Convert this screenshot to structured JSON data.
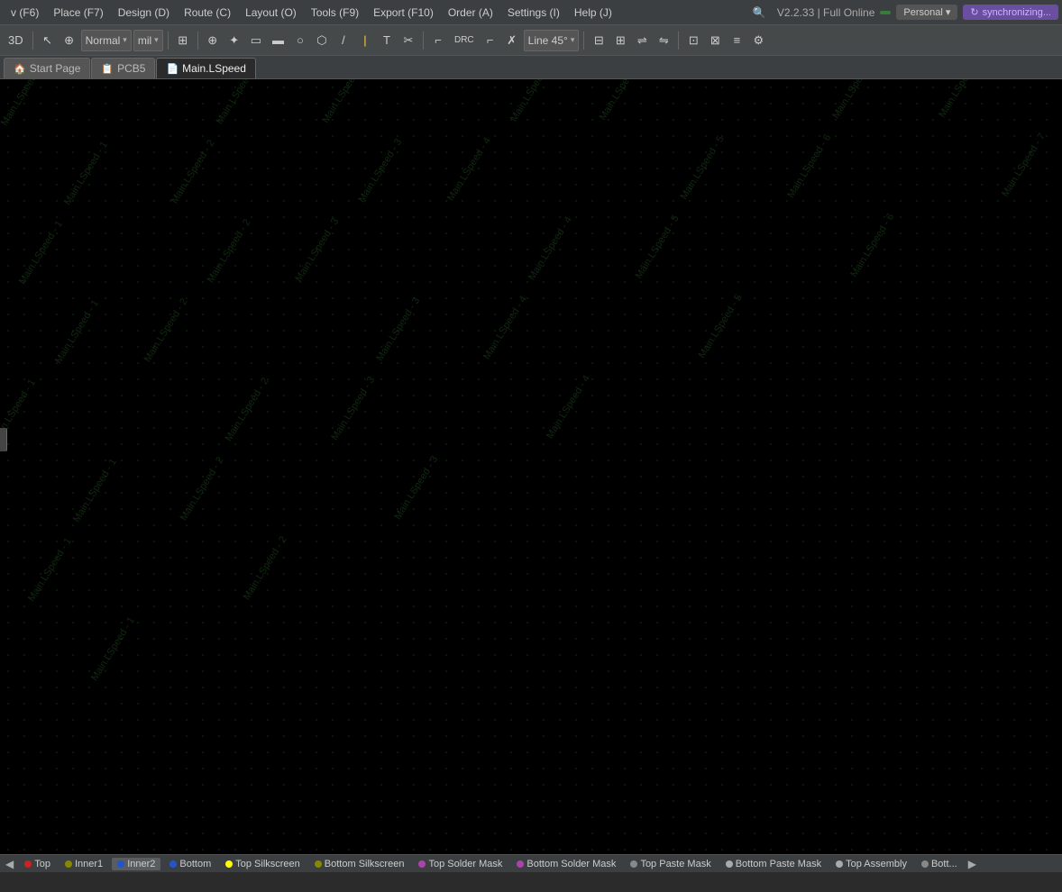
{
  "menubar": {
    "items": [
      {
        "label": "v (F6)",
        "shortcut": "F6"
      },
      {
        "label": "Place (F7)",
        "shortcut": "F7"
      },
      {
        "label": "Design (D)",
        "shortcut": "D"
      },
      {
        "label": "Route (C)",
        "shortcut": "C"
      },
      {
        "label": "Layout (O)",
        "shortcut": "O"
      },
      {
        "label": "Tools (F9)",
        "shortcut": "F9"
      },
      {
        "label": "Export (F10)",
        "shortcut": "F10"
      },
      {
        "label": "Order (A)",
        "shortcut": "A"
      },
      {
        "label": "Settings (I)",
        "shortcut": "I"
      },
      {
        "label": "Help (J)",
        "shortcut": "J"
      }
    ],
    "version": "V2.2.33 | Full Online",
    "personal_label": "Personal",
    "sync_label": "synchronizing..."
  },
  "toolbar": {
    "mode_label": "Normal",
    "unit_label": "mil",
    "line_angle_label": "Line 45°",
    "btn_3d": "3D"
  },
  "tabs": [
    {
      "label": "Start Page",
      "icon": "🏠",
      "active": false
    },
    {
      "label": "PCB5",
      "icon": "📋",
      "active": false
    },
    {
      "label": "Main.LSpeed",
      "icon": "📄",
      "active": true
    }
  ],
  "layers": [
    {
      "label": "Top",
      "color": "#cc2222",
      "active": false
    },
    {
      "label": "Inner1",
      "color": "#888800",
      "active": false
    },
    {
      "label": "Inner2",
      "color": "#2255cc",
      "active": true
    },
    {
      "label": "Bottom",
      "color": "#2255cc",
      "active": false
    },
    {
      "label": "Top Silkscreen",
      "color": "#ffff00",
      "active": false
    },
    {
      "label": "Bottom Silkscreen",
      "color": "#888800",
      "active": false
    },
    {
      "label": "Top Solder Mask",
      "color": "#aa44aa",
      "active": false
    },
    {
      "label": "Bottom Solder Mask",
      "color": "#aa44aa",
      "active": false
    },
    {
      "label": "Top Paste Mask",
      "color": "#888888",
      "active": false
    },
    {
      "label": "Bottom Paste Mask",
      "color": "#aaaaaa",
      "active": false
    },
    {
      "label": "Top Assembly",
      "color": "#aaaaaa",
      "active": false
    },
    {
      "label": "Bott...",
      "color": "#888888",
      "active": false
    }
  ],
  "watermark": {
    "texts": [
      "Main.LSpeed - 1",
      "Main.LSpeed - 2",
      "Main.LSpeed - 3",
      "Main.LSpeed - 4",
      "Main.LSpeed - 5",
      "Main.LSpeed - 6"
    ]
  },
  "icons": {
    "3d": "3D",
    "selection": "↖",
    "point": "⊕",
    "route": "⌐",
    "rect": "▭",
    "rect_fill": "▬",
    "circle": "○",
    "shape": "⬡",
    "line": "/",
    "text": "T",
    "scissors": "✂",
    "drc": "DRC",
    "corner": "⌐",
    "copper": "⌇",
    "layer_select": "⊞",
    "align": "⊟",
    "flip": "⇌",
    "mirror": "⇋",
    "import": "⊡",
    "footprint": "⊠",
    "netlist": "≡",
    "settings": "⚙",
    "search": "🔍",
    "chevron_down": "▾",
    "sync": "↻",
    "arrow_left": "◀",
    "arrow_right": "▶"
  }
}
